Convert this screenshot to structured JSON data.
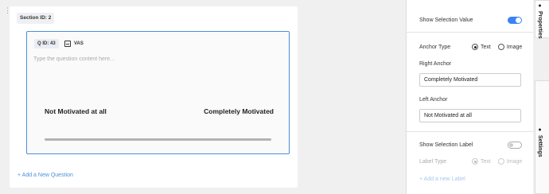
{
  "canvas": {
    "section_badge": "Section ID: 2",
    "question": {
      "id_badge": "Q ID: 43",
      "type_label": "VAS",
      "placeholder": "Type the question content here...",
      "left_anchor": "Not Motivated at all",
      "right_anchor": "Completely Motivated"
    },
    "add_question": "+ Add a New Question"
  },
  "properties": {
    "show_selection_value": {
      "label": "Show Selection Value",
      "enabled": true
    },
    "anchor_type": {
      "label": "Anchor Type",
      "options": [
        "Text",
        "Image"
      ],
      "selected": "Text"
    },
    "right_anchor": {
      "label": "Right Anchor",
      "value": "Completely Motivated"
    },
    "left_anchor": {
      "label": "Left Anchor",
      "value": "Not Motivated at all"
    },
    "show_selection_label": {
      "label": "Show Selection Label",
      "enabled": false
    },
    "label_type": {
      "label": "Label Type",
      "options": [
        "Text",
        "Image"
      ],
      "selected": "Text"
    },
    "add_label": "+ Add a new Label"
  },
  "tabs": {
    "properties": "Properties",
    "settings": "Settings"
  },
  "colors": {
    "accent": "#4a90d9",
    "toggle_on": "#3b82f6"
  }
}
